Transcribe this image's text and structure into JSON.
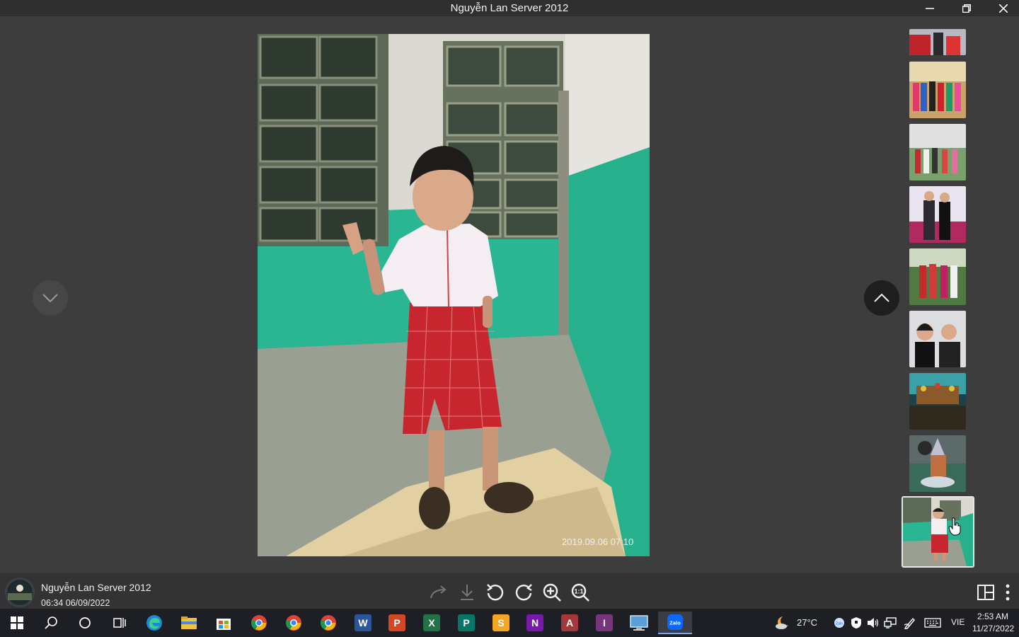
{
  "window": {
    "title": "Nguyễn Lan Server 2012"
  },
  "photo": {
    "timestamp_overlay": "2019.09.06 07:10"
  },
  "footer": {
    "sender_name": "Nguyễn Lan Server 2012",
    "sent_time": "06:34 06/09/2022"
  },
  "taskbar": {
    "apps": [
      "Start",
      "Search",
      "Cortana",
      "Task View",
      "Edge",
      "File Explorer",
      "Microsoft Store",
      "Chrome",
      "Chrome",
      "Chrome",
      "Word",
      "PowerPoint",
      "Excel",
      "Publisher",
      "Slides",
      "OneNote",
      "Access",
      "InfoPath",
      "Remote Desktop",
      "Zalo"
    ],
    "weather": "27°C",
    "language": "VIE",
    "time": "2:53 AM",
    "date": "11/27/2022"
  },
  "colors": {
    "accent": "#3a7bd5",
    "background": "#3d3d3d",
    "titlebar": "#2f2f2f",
    "taskbar": "#1d1f24"
  }
}
